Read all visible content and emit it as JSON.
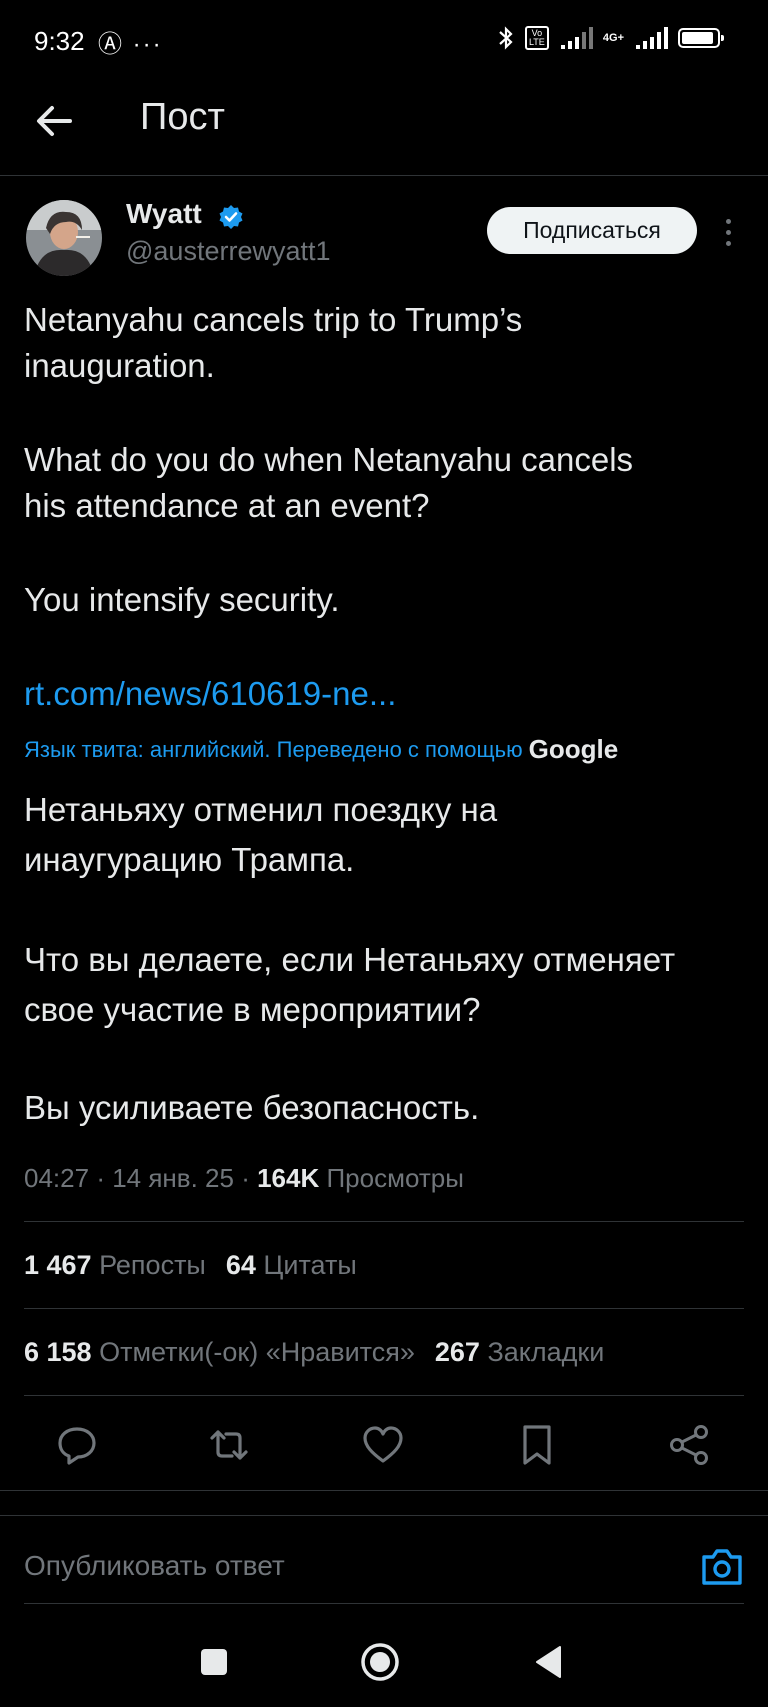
{
  "status_bar": {
    "time": "9:32",
    "left_icons": "Ⓐ ···",
    "volte_label": "Vo LTE",
    "network_label": "4G+",
    "battery_level": 0.9
  },
  "header": {
    "title": "Пост"
  },
  "author": {
    "name": "Wyatt",
    "handle": "@austerrewyatt1",
    "follow_label": "Подписаться"
  },
  "tweet": {
    "lines": [
      "Netanyahu cancels trip to Trump’s",
      "inauguration.",
      "What do you do when Netanyahu cancels",
      "his attendance at an event?",
      "You intensify security."
    ],
    "link": "rt.com/news/610619-ne..."
  },
  "translation": {
    "note": "Язык твита: английский. Переведено с помощью",
    "provider": "Google",
    "lines": [
      "Нетаньяху отменил поездку на",
      "инаугурацию Трампа.",
      "Что вы делаете, если Нетаньяху отменяет",
      "свое участие в мероприятии?",
      "Вы усиливаете безопасность."
    ]
  },
  "meta": {
    "time": "04:27",
    "date": "14 янв. 25",
    "views_count": "164K",
    "views_label": "Просмотры"
  },
  "stats": {
    "reposts_count": "1 467",
    "reposts_label": "Репосты",
    "quotes_count": "64",
    "quotes_label": "Цитаты",
    "likes_count": "6 158",
    "likes_label": "Отметки(-ок) «Нравится»",
    "bookmarks_count": "267",
    "bookmarks_label": "Закладки"
  },
  "reply": {
    "placeholder": "Опубликовать ответ"
  },
  "colors": {
    "accent": "#1d9bf0",
    "background": "#000000",
    "muted": "#71767b",
    "divider": "#2f3336"
  }
}
